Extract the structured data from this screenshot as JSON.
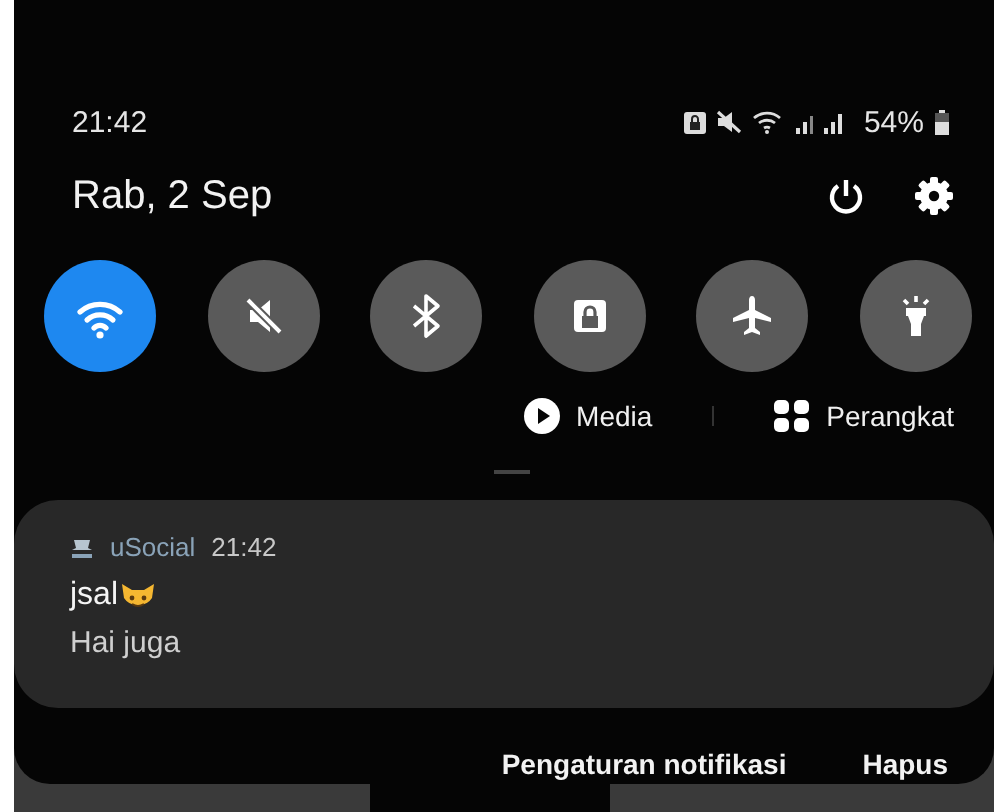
{
  "status_bar": {
    "time": "21:42",
    "battery": "54%"
  },
  "header": {
    "date": "Rab, 2 Sep"
  },
  "quick_tiles": [
    {
      "kind": "wifi",
      "on": true
    },
    {
      "kind": "mute",
      "on": false
    },
    {
      "kind": "bluetooth",
      "on": false
    },
    {
      "kind": "lock",
      "on": false
    },
    {
      "kind": "airplane",
      "on": false
    },
    {
      "kind": "flashlight",
      "on": false
    }
  ],
  "media_buttons": [
    {
      "kind": "media",
      "label": "Media"
    },
    {
      "kind": "devices",
      "label": "Perangkat"
    }
  ],
  "notification": {
    "app": "uSocial",
    "time": "21:42",
    "title": "jsal",
    "body": "Hai juga"
  },
  "actions": [
    "Pengaturan notifikasi",
    "Hapus"
  ]
}
